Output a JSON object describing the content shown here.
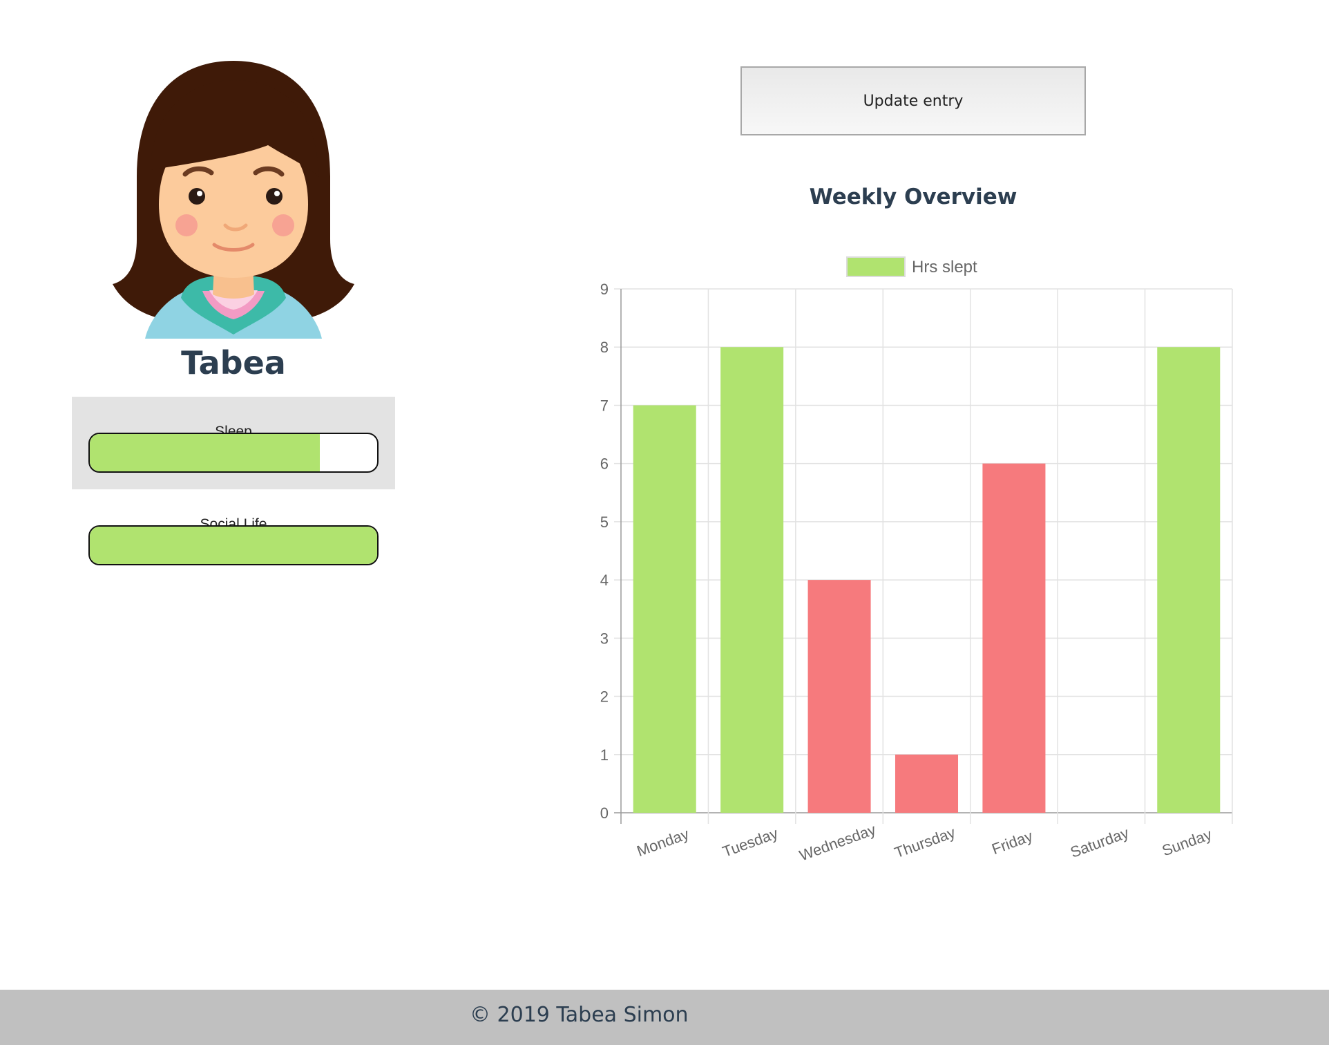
{
  "profile": {
    "name": "Tabea",
    "avatar_icon": "girl-avatar-icon"
  },
  "stats": [
    {
      "label": "Sleep",
      "level": 0.8,
      "active": true
    },
    {
      "label": "Social Life",
      "level": 1.0,
      "active": false
    }
  ],
  "actions": {
    "update_label": "Update entry"
  },
  "chart_title": "Weekly Overview",
  "colors": {
    "good": "#b0e36f",
    "bad": "#f67a7d",
    "heading": "#2c3e50",
    "footer_bg": "#c0c0c0"
  },
  "chart_data": {
    "type": "bar",
    "title": "Weekly Overview",
    "categories": [
      "Monday",
      "Tuesday",
      "Wednesday",
      "Thursday",
      "Friday",
      "Saturday",
      "Sunday"
    ],
    "series": [
      {
        "name": "Hrs slept",
        "values": [
          7,
          8,
          4,
          1,
          6,
          0,
          8
        ]
      }
    ],
    "bar_colors": [
      "#b0e36f",
      "#b0e36f",
      "#f67a7d",
      "#f67a7d",
      "#f67a7d",
      "#f67a7d",
      "#b0e36f"
    ],
    "ylim": [
      0,
      9
    ],
    "yticks": [
      0,
      1,
      2,
      3,
      4,
      5,
      6,
      7,
      8,
      9
    ],
    "grid": true,
    "legend": "top-center",
    "xlabel": "",
    "ylabel": ""
  },
  "footer": {
    "copyright": "© 2019 Tabea Simon"
  }
}
